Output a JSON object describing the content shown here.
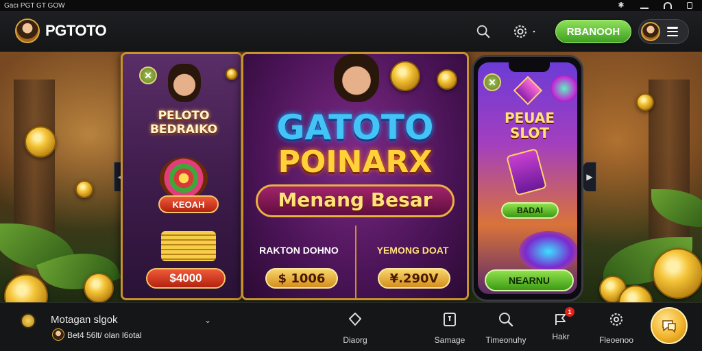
{
  "status_bar": {
    "left_text": "Gacı PGT GT GOW"
  },
  "header": {
    "brand": "PGTOTO",
    "cta_label": "RBANOOH"
  },
  "hero": {
    "left_card": {
      "title_line1": "PELOTO",
      "title_line2": "BEDRAIKO",
      "button_top": "KEOAH",
      "amount": "$4000"
    },
    "main_card": {
      "title_line1": "GATOTO",
      "title_line2": "POINARX",
      "banner": "Menang Besar",
      "left_label": "RAKTON DOHNO",
      "left_amount": "$ 1006",
      "right_label": "YEMONG DOAT",
      "right_amount": "¥.290V"
    },
    "phone_card": {
      "title_line1": "PEUAE",
      "title_line2": "SLOT",
      "small_button": "BADAI",
      "big_button": "NEARNU"
    }
  },
  "bottom": {
    "ticker_title": "Motagan slgok",
    "ticker_sub": "Bet4 56lt/ olan l6otal",
    "nav": [
      {
        "label": "Diaorg"
      },
      {
        "label": "Samage"
      },
      {
        "label": "Timeonuhy"
      },
      {
        "label": "Hakr",
        "badge": "1"
      },
      {
        "label": "Fleoenoo"
      }
    ]
  },
  "colors": {
    "accent_green": "#5cbf2a",
    "gold": "#f2b42a",
    "header_bg": "#1a1b1e"
  }
}
